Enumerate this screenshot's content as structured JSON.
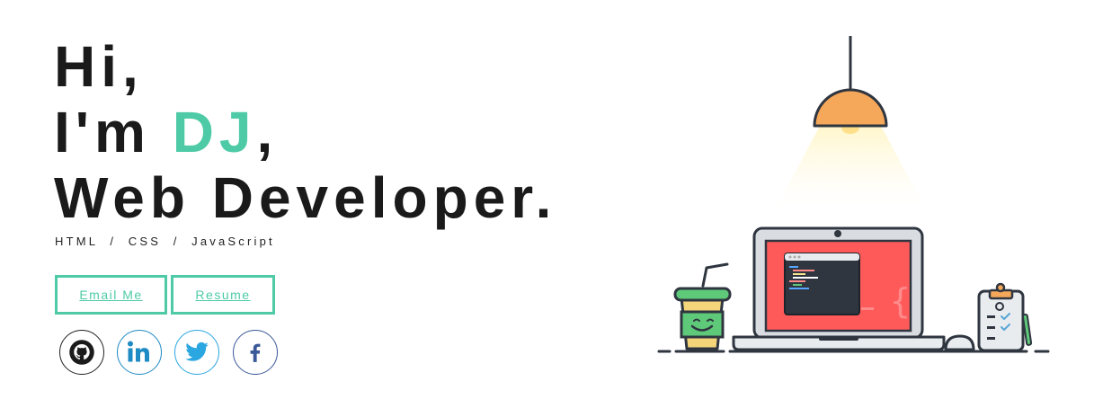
{
  "hero": {
    "greeting": "Hi,",
    "intro_prefix": "I'm ",
    "name": "DJ",
    "intro_suffix": ",",
    "role": "Web Developer."
  },
  "skills": "HTML  /  CSS  /  JavaScript",
  "buttons": {
    "email_label": "Email Me",
    "resume_label": "Resume"
  },
  "social": [
    {
      "icon": "github-icon"
    },
    {
      "icon": "linkedin-icon"
    },
    {
      "icon": "twitter-icon"
    },
    {
      "icon": "facebook-icon"
    }
  ],
  "colors": {
    "accent": "#4ecba6",
    "text": "#1a1a1a",
    "screen": "#ff5a5a",
    "lamp": "#f6a85a"
  }
}
